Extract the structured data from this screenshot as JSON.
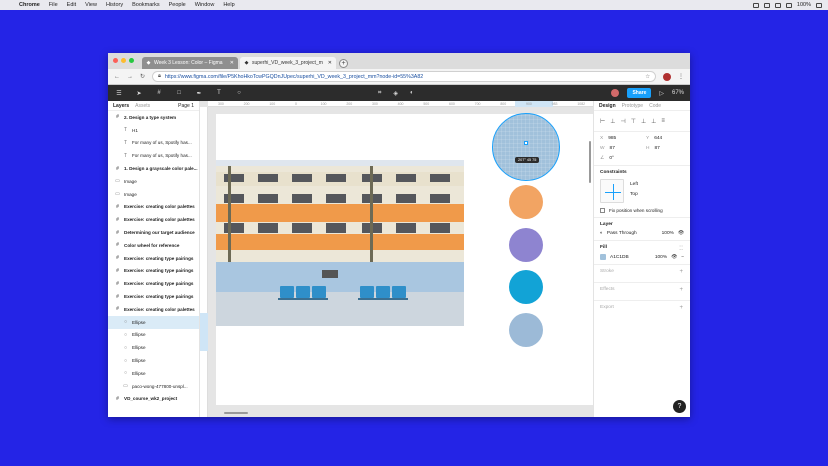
{
  "menubar": {
    "items": [
      "Chrome",
      "File",
      "Edit",
      "View",
      "History",
      "Bookmarks",
      "People",
      "Window",
      "Help"
    ],
    "battery": "100%",
    "apple_icon": "apple-icon"
  },
  "browser": {
    "tabs": [
      {
        "title": "Week 3 Lesson: Color – Figma",
        "active": true
      },
      {
        "title": "superhi_VD_week_3_project_m",
        "active": false
      }
    ],
    "url": "https://www.figma.com/file/P5KhoHkoTcwPGQDnJUpec/superhi_VD_week_3_project_mm?node-id=55%3A82",
    "traffic_colors": [
      "#fc5f57",
      "#fdbc2e",
      "#27c840"
    ]
  },
  "toolbar": {
    "share_label": "Share",
    "zoom": "67%",
    "play_icon": "play-icon"
  },
  "layers_panel": {
    "tab_layers": "Layers",
    "tab_assets": "Assets",
    "page": "Page 1",
    "rows": [
      {
        "label": "2. Design a type system",
        "kind": "frame",
        "bold": true,
        "indent": 0
      },
      {
        "label": "H1",
        "kind": "text",
        "indent": 1
      },
      {
        "label": "For many of us, Spotify has...",
        "kind": "text",
        "indent": 1
      },
      {
        "label": "For many of us, Spotify has...",
        "kind": "text",
        "indent": 1
      },
      {
        "label": "1. Design a grayscale color pale...",
        "kind": "frame",
        "bold": true,
        "indent": 0
      },
      {
        "label": "Image",
        "kind": "image",
        "indent": 0
      },
      {
        "label": "Image",
        "kind": "image",
        "indent": 0
      },
      {
        "label": "Exercise: creating color palettes",
        "kind": "frame",
        "bold": true,
        "indent": 0
      },
      {
        "label": "Exercise: creating color palettes",
        "kind": "frame",
        "bold": true,
        "indent": 0
      },
      {
        "label": "Determining our target audience",
        "kind": "frame",
        "bold": true,
        "indent": 0
      },
      {
        "label": "Color wheel for reference",
        "kind": "frame",
        "bold": true,
        "indent": 0
      },
      {
        "label": "Exercise: creating type pairings",
        "kind": "frame",
        "bold": true,
        "indent": 0
      },
      {
        "label": "Exercise: creating type pairings",
        "kind": "frame",
        "bold": true,
        "indent": 0
      },
      {
        "label": "Exercise: creating type pairings",
        "kind": "frame",
        "bold": true,
        "indent": 0
      },
      {
        "label": "Exercise: creating type pairings",
        "kind": "frame",
        "bold": true,
        "indent": 0
      },
      {
        "label": "Exercise: creating color palettes",
        "kind": "frame",
        "bold": true,
        "indent": 0
      },
      {
        "label": "Ellipse",
        "kind": "ellipse",
        "indent": 1,
        "selected": true
      },
      {
        "label": "Ellipse",
        "kind": "ellipse",
        "indent": 1
      },
      {
        "label": "Ellipse",
        "kind": "ellipse",
        "indent": 1
      },
      {
        "label": "Ellipse",
        "kind": "ellipse",
        "indent": 1
      },
      {
        "label": "Ellipse",
        "kind": "ellipse",
        "indent": 1
      },
      {
        "label": "paco-wong-477800-unspl...",
        "kind": "image",
        "indent": 1
      },
      {
        "label": "VD_course_wk2_project",
        "kind": "frame",
        "bold": true,
        "indent": 0
      }
    ]
  },
  "canvas": {
    "ruler_top": [
      "300",
      "200",
      "100",
      "0",
      "100",
      "200",
      "300",
      "400",
      "500",
      "600",
      "700",
      "800",
      "900",
      "983",
      "1082"
    ],
    "selection_size": "207° 45 75",
    "photo_label": "Building photo",
    "circles": [
      {
        "color": "#A1C1DB",
        "selected": true
      },
      {
        "color": "#F2A463"
      },
      {
        "color": "#8E84D0"
      },
      {
        "color": "#12A3D6"
      },
      {
        "color": "#9CBAD7"
      }
    ]
  },
  "design_panel": {
    "tab_design": "Design",
    "tab_prototype": "Prototype",
    "tab_code": "Code",
    "x_label": "X",
    "x": "985",
    "y_label": "Y",
    "y": "644",
    "w_label": "W",
    "w": "87",
    "h_label": "H",
    "h": "87",
    "rotation": "0°",
    "constraints_title": "Constraints",
    "constraint_h": "Left",
    "constraint_v": "Top",
    "fix_position": "Fix position when scrolling",
    "layer_title": "Layer",
    "blend": "Pass Through",
    "layer_opacity": "100%",
    "fill_title": "Fill",
    "fill_hex": "A1C1DB",
    "fill_color": "#A1C1DB",
    "fill_opacity": "100%",
    "stroke_title": "Stroke",
    "effects_title": "Effects",
    "export_title": "Export",
    "help_label": "?"
  }
}
